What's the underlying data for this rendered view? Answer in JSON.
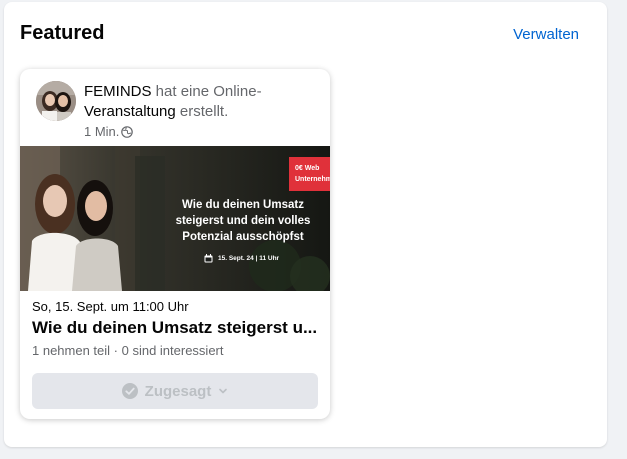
{
  "section": {
    "title": "Featured",
    "manage_label": "Verwalten"
  },
  "post": {
    "author": "FEMINDS",
    "action_prefix": "hat eine Online-",
    "event_word": "Veranstaltung",
    "action_suffix": "erstellt.",
    "time": "1 Min.",
    "privacy_icon": "globe-icon"
  },
  "event_image": {
    "banner_line1": "0€ Web",
    "banner_line2": "Unternehm",
    "headline_line1": "Wie du deinen Umsatz",
    "headline_line2": "steigerst und dein volles",
    "headline_line3": "Potenzial ausschöpfst",
    "date_text": "15. Sept. 24 | 11 Uhr"
  },
  "event": {
    "date": "So, 15. Sept. um 11:00 Uhr",
    "title": "Wie du deinen Umsatz steigerst u...",
    "stats": "1 nehmen teil · 0 sind interessiert",
    "rsvp_label": "Zugesagt",
    "rsvp_icon": "check-circle-icon",
    "dropdown_icon": "chevron-down-icon"
  },
  "colors": {
    "link": "#0064d1",
    "banner_red": "#e0313a",
    "button_bg": "#e4e6eb",
    "button_text": "#bcc0c4"
  }
}
